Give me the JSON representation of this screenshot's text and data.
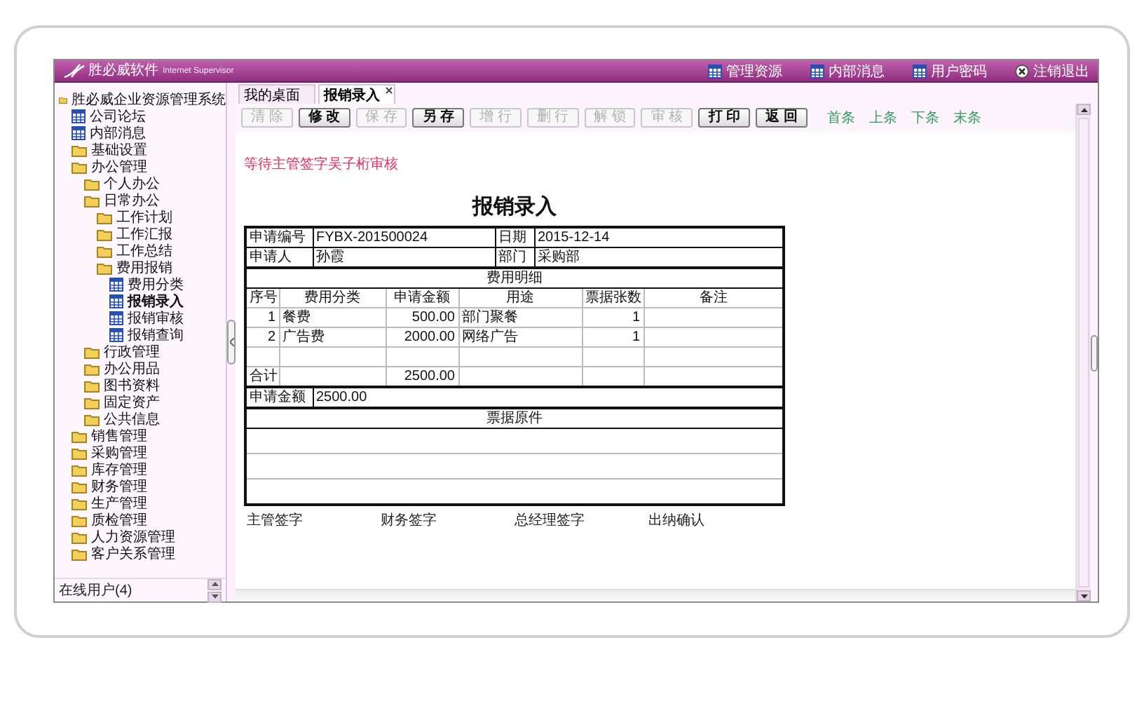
{
  "header": {
    "logo_title": "胜必威软件",
    "logo_subtitle": "Internet Supervisor",
    "links": [
      {
        "label": "管理资源",
        "kind": "page"
      },
      {
        "label": "内部消息",
        "kind": "page"
      },
      {
        "label": "用户密码",
        "kind": "page"
      },
      {
        "label": "注销退出",
        "kind": "logout"
      }
    ]
  },
  "sidebar": {
    "tree": [
      {
        "label": "胜必威企业资源管理系统",
        "kind": "folder",
        "selected": false,
        "children": [
          {
            "label": "公司论坛",
            "kind": "page",
            "selected": false
          },
          {
            "label": "内部消息",
            "kind": "page",
            "selected": false
          },
          {
            "label": "基础设置",
            "kind": "folder",
            "selected": false
          },
          {
            "label": "办公管理",
            "kind": "folder",
            "selected": false,
            "children": [
              {
                "label": "个人办公",
                "kind": "folder",
                "selected": false
              },
              {
                "label": "日常办公",
                "kind": "folder",
                "selected": false,
                "children": [
                  {
                    "label": "工作计划",
                    "kind": "folder",
                    "selected": false
                  },
                  {
                    "label": "工作汇报",
                    "kind": "folder",
                    "selected": false
                  },
                  {
                    "label": "工作总结",
                    "kind": "folder",
                    "selected": false
                  },
                  {
                    "label": "费用报销",
                    "kind": "folder",
                    "selected": false,
                    "children": [
                      {
                        "label": "费用分类",
                        "kind": "page",
                        "selected": false
                      },
                      {
                        "label": "报销录入",
                        "kind": "page",
                        "selected": true
                      },
                      {
                        "label": "报销审核",
                        "kind": "page",
                        "selected": false
                      },
                      {
                        "label": "报销查询",
                        "kind": "page",
                        "selected": false
                      }
                    ]
                  }
                ]
              },
              {
                "label": "行政管理",
                "kind": "folder",
                "selected": false
              },
              {
                "label": "办公用品",
                "kind": "folder",
                "selected": false
              },
              {
                "label": "图书资料",
                "kind": "folder",
                "selected": false
              },
              {
                "label": "固定资产",
                "kind": "folder",
                "selected": false
              },
              {
                "label": "公共信息",
                "kind": "folder",
                "selected": false
              }
            ]
          },
          {
            "label": "销售管理",
            "kind": "folder",
            "selected": false
          },
          {
            "label": "采购管理",
            "kind": "folder",
            "selected": false
          },
          {
            "label": "库存管理",
            "kind": "folder",
            "selected": false
          },
          {
            "label": "财务管理",
            "kind": "folder",
            "selected": false
          },
          {
            "label": "生产管理",
            "kind": "folder",
            "selected": false
          },
          {
            "label": "质检管理",
            "kind": "folder",
            "selected": false
          },
          {
            "label": "人力资源管理",
            "kind": "folder",
            "selected": false
          },
          {
            "label": "客户关系管理",
            "kind": "folder",
            "selected": false
          }
        ]
      }
    ],
    "footer": "在线用户(4)"
  },
  "tabs": [
    {
      "label": "我的桌面",
      "selected": false,
      "closable": false
    },
    {
      "label": "报销录入",
      "selected": true,
      "closable": true
    }
  ],
  "toolbar": [
    {
      "label": "清 除",
      "disabled": true
    },
    {
      "label": "修 改",
      "disabled": false
    },
    {
      "label": "保 存",
      "disabled": true
    },
    {
      "label": "另 存",
      "disabled": false
    },
    {
      "label": "增 行",
      "disabled": true
    },
    {
      "label": "删 行",
      "disabled": true
    },
    {
      "label": "解 锁",
      "disabled": true
    },
    {
      "label": "审 核",
      "disabled": true
    },
    {
      "label": "打 印",
      "disabled": false
    },
    {
      "label": "返 回",
      "disabled": false
    }
  ],
  "record_nav": [
    "首条",
    "上条",
    "下条",
    "末条"
  ],
  "status_message": "等待主管签字吴子桁审核",
  "form": {
    "title": "报销录入",
    "fields": [
      {
        "label": "申请编号",
        "value": "FYBX-201500024"
      },
      {
        "label": "日期",
        "value": "2015-12-14"
      },
      {
        "label": "申请人",
        "value": "孙霞"
      },
      {
        "label": "部门",
        "value": "采购部"
      }
    ],
    "details": {
      "title": "费用明细",
      "columns": [
        "序号",
        "费用分类",
        "申请金额",
        "用途",
        "票据张数",
        "备注"
      ],
      "rows": [
        {
          "no": "1",
          "category": "餐费",
          "amount": "500.00",
          "purpose": "部门聚餐",
          "receipts": "1"
        },
        {
          "no": "2",
          "category": "广告费",
          "amount": "2000.00",
          "purpose": "网络广告",
          "receipts": "1"
        }
      ],
      "total": {
        "label": "合计",
        "amount": "2500.00"
      }
    },
    "request_amount": {
      "label": "申请金额",
      "value": "2500.00"
    },
    "attachments": {
      "title": "票据原件"
    },
    "signatures": [
      "主管签字",
      "财务签字",
      "总经理签字",
      "出纳确认"
    ]
  }
}
